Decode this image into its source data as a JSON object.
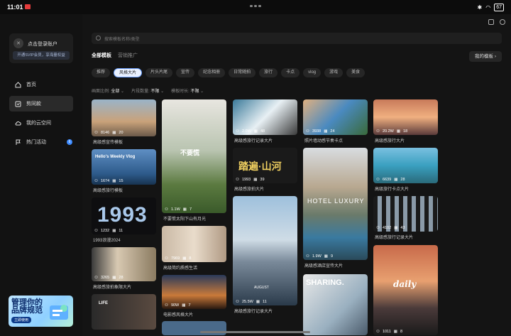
{
  "status": {
    "time": "11:01",
    "battery": "67"
  },
  "sidebar": {
    "login_title": "点击登录账户",
    "vip_text": "开通SVIP会员，享海量权益",
    "items": [
      {
        "label": "首页"
      },
      {
        "label": "剪同款"
      },
      {
        "label": "我的云空间"
      },
      {
        "label": "热门活动",
        "badge": "6"
      }
    ],
    "promo": {
      "line1": "管理你的",
      "line2": "品牌规范",
      "button": "立即使用"
    }
  },
  "search": {
    "placeholder": "搜索模板名称/类型"
  },
  "tabs": [
    {
      "label": "全部模板"
    },
    {
      "label": "营销推广"
    }
  ],
  "my_templates": "我的模板",
  "chips": [
    "推荐",
    "风格大片",
    "片头片尾",
    "宣传",
    "纪念相册",
    "日常随拍",
    "旅行",
    "卡点",
    "vlog",
    "游戏",
    "美食"
  ],
  "filters": [
    {
      "label": "画面比例:",
      "value": "全部"
    },
    {
      "label": "片段数量:",
      "value": "不限"
    },
    {
      "label": "模板时长:",
      "value": "不限"
    }
  ],
  "cards": [
    {
      "stat": "8146",
      "clips": "20",
      "caption": "高级感宣传模板"
    },
    {
      "stat": "1674",
      "clips": "15",
      "caption": "高级感旅行模板",
      "overlay": "Hello's Weekly Vlog"
    },
    {
      "stat": "1232",
      "clips": "11",
      "caption": "1993浪漫2024",
      "overlay": "1993"
    },
    {
      "stat": "3265",
      "clips": "28",
      "caption": "高级感旅拍象限大片"
    },
    {
      "stat": "",
      "clips": "",
      "caption": "",
      "overlay": "LIFE"
    },
    {
      "stat": "1.1W",
      "clips": "7",
      "caption": "不要慌太阳下山有月光",
      "overlay": "不要慌"
    },
    {
      "stat": "7969",
      "clips": "8",
      "caption": "高级简约质感生活"
    },
    {
      "stat": "90W",
      "clips": "7",
      "caption": "电影感风格大片"
    },
    {
      "stat": "2.0W",
      "clips": "48",
      "caption": "高级感旅行记录大片"
    },
    {
      "stat": "1993",
      "clips": "39",
      "caption": "高级感旅拍大片",
      "overlay": "踏遍·山河"
    },
    {
      "stat": "25.5W",
      "clips": "11",
      "caption": "高级感旅行记录大片",
      "overlay": "AUGUST"
    },
    {
      "stat": "3938",
      "clips": "24",
      "caption": "照片墙动感节奏卡点"
    },
    {
      "stat": "1.9W",
      "clips": "9",
      "caption": "高级感酒店宣传大片",
      "overlay": "HOTEL LUXURY"
    },
    {
      "stat": "",
      "clips": "",
      "caption": "",
      "overlay": "SHARING."
    },
    {
      "stat": "20.2W",
      "clips": "18",
      "caption": "高级感旅行大片"
    },
    {
      "stat": "6639",
      "clips": "28",
      "caption": "高级旅行卡点大片"
    },
    {
      "stat": "4102",
      "clips": "43",
      "caption": "高级感旅行记录大片"
    },
    {
      "stat": "1011",
      "clips": "8",
      "caption": "",
      "overlay": "daily"
    }
  ]
}
